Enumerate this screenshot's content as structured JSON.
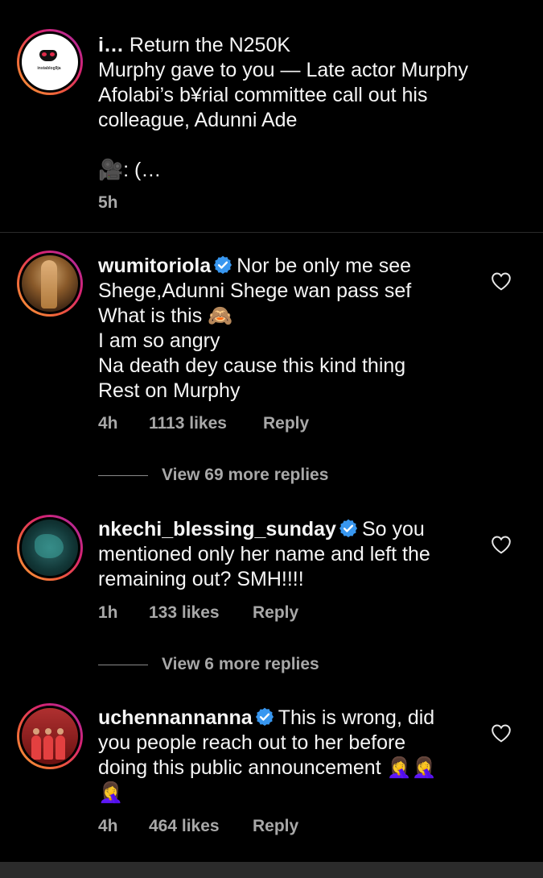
{
  "caption": {
    "username": "i…",
    "line1": "Return the N250K",
    "line2": "Murphy gave to you — Late actor Murphy",
    "line3": "Afolabi’s b¥rial committee call out his",
    "line4": "colleague, Adunni Ade",
    "credit_prefix": "🎥: ",
    "credit_redacted": "(…",
    "time": "5h",
    "avatar_text": "instablog9ja"
  },
  "comments": [
    {
      "username": "wumitoriola",
      "lines": [
        "Nor be only me see",
        "Shege,Adunni Shege wan pass sef",
        "What is this 🙈",
        "I am so angry",
        "Na death dey cause this kind thing",
        "Rest on Murphy"
      ],
      "time": "4h",
      "likes": "1113 likes",
      "reply_label": "Reply",
      "view_replies": "View 69 more replies"
    },
    {
      "username": "nkechi_blessing_sunday",
      "lines": [
        "So you",
        "mentioned only her name and left the",
        "remaining out? SMH!!!!"
      ],
      "time": "1h",
      "likes": "133 likes",
      "reply_label": "Reply",
      "view_replies": "View 6 more replies"
    },
    {
      "username": "uchennannanna",
      "lines": [
        "This is wrong, did",
        "you people reach out to her before",
        "doing this public announcement 🤦‍♀️🤦‍♀️",
        "🤦‍♀️"
      ],
      "time": "4h",
      "likes": "464 likes",
      "reply_label": "Reply"
    }
  ],
  "colors": {
    "verified": "#3897f0",
    "meta_text": "#a8a8a8",
    "background": "#000000"
  },
  "icons": {
    "verified": "verified-badge-icon",
    "like": "heart-outline-icon"
  }
}
